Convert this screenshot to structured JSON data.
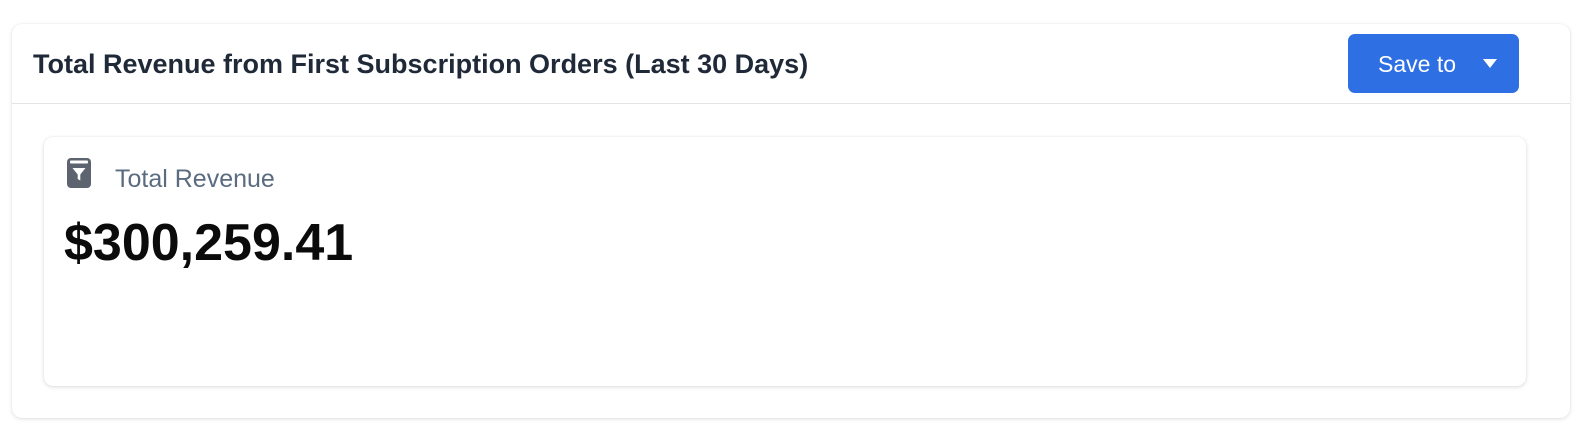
{
  "header": {
    "title": "Total Revenue from First Subscription Orders (Last 30 Days)",
    "save_label": "Save to",
    "save_icon": "chevron-down-icon"
  },
  "metric": {
    "icon": "filter-report-icon",
    "label": "Total Revenue",
    "value": "$300,259.41"
  },
  "colors": {
    "accent": "#2f6fe4",
    "icon": "#5d6470",
    "label": "#5b6b80",
    "title": "#1f2937"
  }
}
